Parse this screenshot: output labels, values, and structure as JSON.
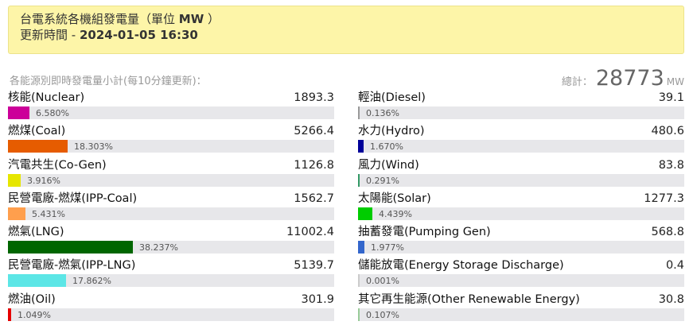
{
  "header": {
    "title_prefix": "台電系統各機組發電量（單位 ",
    "title_unit": "MW",
    "title_suffix": " ）",
    "updated_label": "更新時間 - ",
    "updated_time": "2024-01-05 16:30"
  },
  "subtitle": "各能源別即時發電量小計(每10分鐘更新)：",
  "total": {
    "label": "總計：",
    "value": "28773",
    "unit": "MW"
  },
  "left": [
    {
      "name": "核能(Nuclear)",
      "value": "1893.3",
      "percent": "6.580%",
      "fraction": 0.0658,
      "color": "#cc0099"
    },
    {
      "name": "燃煤(Coal)",
      "value": "5266.4",
      "percent": "18.303%",
      "fraction": 0.18303,
      "color": "#e65c00"
    },
    {
      "name": "汽電共生(Co-Gen)",
      "value": "1126.8",
      "percent": "3.916%",
      "fraction": 0.03916,
      "color": "#e6e600"
    },
    {
      "name": "民營電廠-燃煤(IPP-Coal)",
      "value": "1562.7",
      "percent": "5.431%",
      "fraction": 0.05431,
      "color": "#ff9f4d"
    },
    {
      "name": "燃氣(LNG)",
      "value": "11002.4",
      "percent": "38.237%",
      "fraction": 0.38237,
      "color": "#006600"
    },
    {
      "name": "民營電廠-燃氣(IPP-LNG)",
      "value": "5139.7",
      "percent": "17.862%",
      "fraction": 0.17862,
      "color": "#5ce6e6"
    },
    {
      "name": "燃油(Oil)",
      "value": "301.9",
      "percent": "1.049%",
      "fraction": 0.01049,
      "color": "#e60000"
    }
  ],
  "right": [
    {
      "name": "輕油(Diesel)",
      "value": "39.1",
      "percent": "0.136%",
      "fraction": 0.00136,
      "color": "#999999"
    },
    {
      "name": "水力(Hydro)",
      "value": "480.6",
      "percent": "1.670%",
      "fraction": 0.0167,
      "color": "#000099"
    },
    {
      "name": "風力(Wind)",
      "value": "83.8",
      "percent": "0.291%",
      "fraction": 0.00291,
      "color": "#339966"
    },
    {
      "name": "太陽能(Solar)",
      "value": "1277.3",
      "percent": "4.439%",
      "fraction": 0.04439,
      "color": "#00cc00"
    },
    {
      "name": "抽蓄發電(Pumping Gen)",
      "value": "568.8",
      "percent": "1.977%",
      "fraction": 0.01977,
      "color": "#3366cc"
    },
    {
      "name": "儲能放電(Energy Storage Discharge)",
      "value": "0.4",
      "percent": "0.001%",
      "fraction": 1e-05,
      "color": "#cccccc"
    },
    {
      "name": "其它再生能源(Other Renewable Energy)",
      "value": "30.8",
      "percent": "0.107%",
      "fraction": 0.00107,
      "color": "#99cc99"
    }
  ]
}
